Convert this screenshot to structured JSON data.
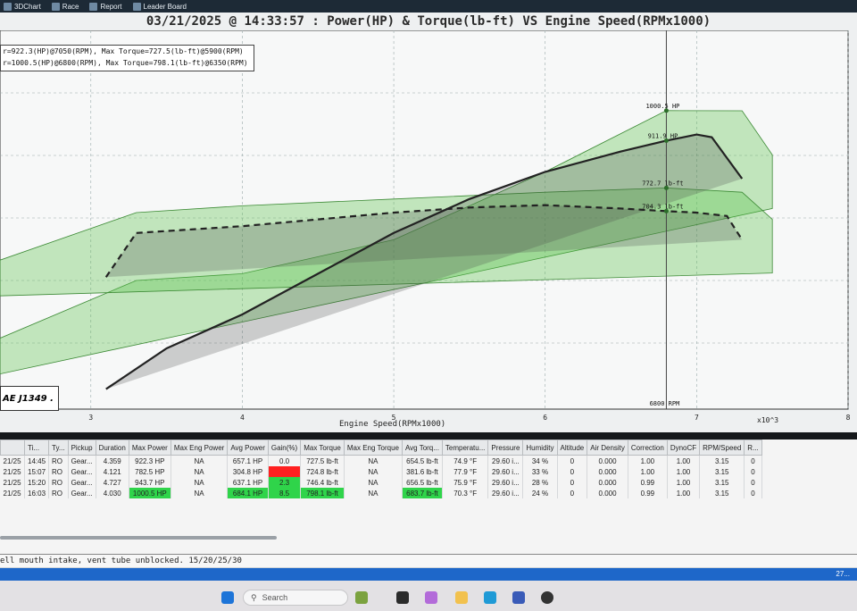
{
  "menu": {
    "items": [
      {
        "label": "3DChart",
        "icon": "chart-3d-icon"
      },
      {
        "label": "Race",
        "icon": "flag-icon"
      },
      {
        "label": "Report",
        "icon": "report-icon"
      },
      {
        "label": "Leader Board",
        "icon": "leaderboard-icon"
      }
    ]
  },
  "chart": {
    "title": "03/21/2025 @ 14:33:57 : Power(HP) & Torque(lb-ft) VS Engine Speed(RPMx1000)",
    "legend_line1": "r=922.3(HP)@7050(RPM), Max Torque=727.5(lb-ft)@5900(RPM)",
    "legend_line2": "r=1000.5(HP)@6800(RPM), Max Torque=798.1(lb-ft)@6350(RPM)",
    "standard": "AE J1349 .",
    "xlabel": "Engine Speed(RPMx1000)",
    "xscale": "x10^3",
    "cursor_label": "6800 RPM",
    "annotations": {
      "hp_max": "1000.5 HP",
      "hp_cursor": "911.9 HP",
      "tq_max": "772.7 lb-ft",
      "tq_cursor": "704.3 lb-ft"
    }
  },
  "chart_data": {
    "type": "line",
    "title": "03/21/2025 @ 14:33:57 : Power(HP) & Torque(lb-ft) VS Engine Speed(RPMx1000)",
    "xlabel": "Engine Speed(RPMx1000)",
    "xticks": [
      "3",
      "4",
      "5",
      "6",
      "7",
      "8"
    ],
    "xlim": [
      2.4,
      8
    ],
    "cursor_x": 6.8,
    "series": [
      {
        "style": "solid",
        "x": [
          3.1,
          3.5,
          4.0,
          4.5,
          5.0,
          5.5,
          6.0,
          6.5,
          6.8,
          7.0,
          7.1,
          7.3
        ],
        "y": [
          180,
          300,
          400,
          520,
          640,
          740,
          820,
          880,
          911.9,
          930,
          922,
          800
        ]
      },
      {
        "style": "dashed",
        "x": [
          3.1,
          3.3,
          4.0,
          4.5,
          5.0,
          5.5,
          6.0,
          6.5,
          6.8,
          7.0,
          7.2,
          7.3
        ],
        "y": [
          510,
          640,
          660,
          680,
          700,
          715,
          722,
          712,
          704.3,
          700,
          690,
          620
        ]
      },
      {
        "style": "band",
        "x": [
          2.4,
          3.3,
          4.0,
          5.0,
          6.0,
          6.8,
          7.3,
          7.5
        ],
        "y": [
          330,
          500,
          520,
          620,
          820,
          1000.5,
          1000,
          870
        ]
      },
      {
        "style": "band",
        "x": [
          2.4,
          3.3,
          4.0,
          5.0,
          6.0,
          6.8,
          7.3,
          7.5
        ],
        "y": [
          560,
          700,
          720,
          740,
          760,
          772.7,
          760,
          680
        ]
      }
    ],
    "grid": true
  },
  "table": {
    "headers": [
      "Ti...",
      "Ty...",
      "Pickup",
      "Duration",
      "Max Power",
      "Max Eng Power",
      "Avg Power",
      "Gain(%)",
      "Max Torque",
      "Max Eng Torque",
      "Avg Torq...",
      "Temperatu...",
      "Pressure",
      "Humidity",
      "Altitude",
      "Air Density",
      "Correction",
      "DynoCF",
      "RPM/Speed",
      "R..."
    ],
    "rows": [
      {
        "date": "21/25",
        "cells": [
          "14:45",
          "RO",
          "Gear...",
          "4.359",
          "922.3 HP",
          "NA",
          "657.1 HP",
          "0.0",
          "727.5 lb-ft",
          "NA",
          "654.5 lb-ft",
          "74.9 °F",
          "29.60 i...",
          "34 %",
          "0",
          "0.000",
          "1.00",
          "1.00",
          "3.15",
          "0"
        ],
        "hl": {}
      },
      {
        "date": "21/25",
        "cells": [
          "15:07",
          "RO",
          "Gear...",
          "4.121",
          "782.5 HP",
          "NA",
          "304.8 HP",
          "",
          "724.8 lb-ft",
          "NA",
          "381.6 lb-ft",
          "77.9 °F",
          "29.60 i...",
          "33 %",
          "0",
          "0.000",
          "1.00",
          "1.00",
          "3.15",
          "0"
        ],
        "hl": {
          "7": "r"
        }
      },
      {
        "date": "21/25",
        "cells": [
          "15:20",
          "RO",
          "Gear...",
          "4.727",
          "943.7 HP",
          "NA",
          "637.1 HP",
          "2.3",
          "746.4 lb-ft",
          "NA",
          "656.5 lb-ft",
          "75.9 °F",
          "29.60 i...",
          "28 %",
          "0",
          "0.000",
          "0.99",
          "1.00",
          "3.15",
          "0"
        ],
        "hl": {
          "7": "g"
        }
      },
      {
        "date": "21/25",
        "cells": [
          "16:03",
          "RO",
          "Gear...",
          "4.030",
          "1000.5 HP",
          "NA",
          "684.1 HP",
          "8.5",
          "798.1 lb-ft",
          "NA",
          "683.7 lb-ft",
          "70.3 °F",
          "29.60 i...",
          "24 %",
          "0",
          "0.000",
          "0.99",
          "1.00",
          "3.15",
          "0"
        ],
        "hl": {
          "4": "g",
          "6": "g",
          "7": "g",
          "8": "g",
          "10": "g"
        }
      }
    ]
  },
  "notes": "ell mouth intake, vent tube unblocked. 15/20/25/30",
  "bluebar_text": "27...",
  "taskbar": {
    "search_placeholder": "Search"
  },
  "colors": {
    "accent_blue": "#1e67c9",
    "gain_green": "#2fd44a",
    "loss_red": "#ff2020",
    "band_green": "#5cc24e"
  }
}
